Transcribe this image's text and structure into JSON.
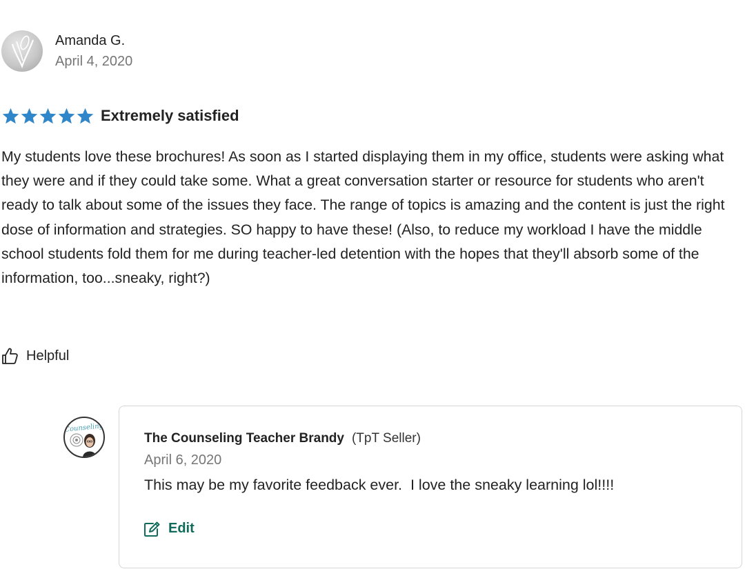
{
  "review": {
    "reviewer_name": "Amanda G.",
    "date": "April 4, 2020",
    "rating": 5,
    "rating_max": 5,
    "rating_label": "Extremely satisfied",
    "body": "My students love these brochures! As soon as I started displaying them in my office, students were asking what they were and if they could take some. What a great conversation starter or resource for students who aren't ready to talk about some of the issues they face. The range of topics is amazing and the content is just the right dose of information and strategies. SO happy to have these! (Also, to reduce my workload I have the middle school students fold them for me during teacher-led detention with the hopes that they'll absorb some of the information, too...sneaky, right?)",
    "helpful_label": "Helpful"
  },
  "reply": {
    "seller_name": "The Counseling Teacher Brandy",
    "seller_badge": "(TpT Seller)",
    "date": "April 6, 2020",
    "text": "This may be my favorite feedback ever.  I love the sneaky learning lol!!!!",
    "edit_label": "Edit",
    "avatar_logo_text": "Counseling"
  },
  "colors": {
    "star": "#2f86c9",
    "edit_accent": "#106b5b",
    "muted_text": "#767676",
    "card_border": "#d6d6d6"
  },
  "icons": {
    "rating": "star-icon",
    "helpful": "thumbs-up-icon",
    "edit": "edit-icon"
  }
}
